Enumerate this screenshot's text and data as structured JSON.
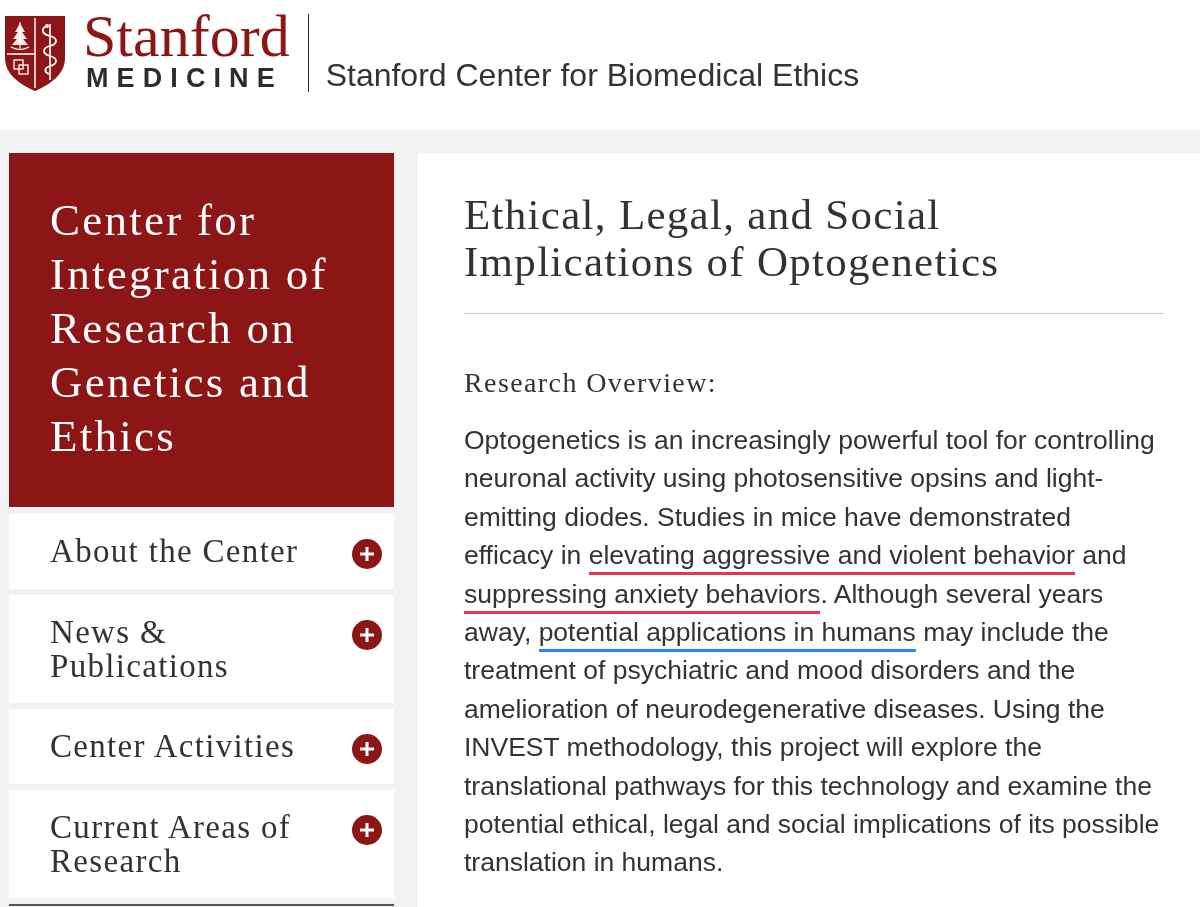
{
  "header": {
    "wordmark": "Stanford",
    "wordmark_sub": "MEDICINE",
    "site_title": "Stanford Center for Biomedical Ethics"
  },
  "sidebar": {
    "title": "Center for Integration of Research on Genetics and Ethics",
    "items": [
      {
        "label": "About the Center",
        "expanded": false
      },
      {
        "label": "News & Publications",
        "expanded": false
      },
      {
        "label": "Center Activities",
        "expanded": false
      },
      {
        "label": "Current Areas of Research",
        "expanded": false
      }
    ]
  },
  "main": {
    "title": "Ethical, Legal, and Social Implications of Optogenetics",
    "section_heading": "Research Overview:",
    "paragraph": [
      {
        "text": "Optogenetics is an increasingly powerful tool for controlling neuronal activity using photosensitive opsins and light-emitting diodes. Studies in mice have demonstrated efficacy in ",
        "underlined": false
      },
      {
        "text": "elevating aggressive and violent behavior",
        "underlined": true,
        "color": "#e8354c"
      },
      {
        "text": " and ",
        "underlined": false
      },
      {
        "text": "suppressing anxiety behaviors",
        "underlined": true,
        "color": "#e8354c"
      },
      {
        "text": ". Although several years away, ",
        "underlined": false
      },
      {
        "text": "potential applications in humans",
        "underlined": true,
        "color": "#2f86e6"
      },
      {
        "text": " may include the treatment of psychiatric and mood disorders and the amelioration of neurodegenerative diseases. Using the INVEST methodology, this project will explore the translational pathways for this technology and examine the potential ethical, legal and social implications of its possible translation in humans.",
        "underlined": false
      }
    ]
  }
}
